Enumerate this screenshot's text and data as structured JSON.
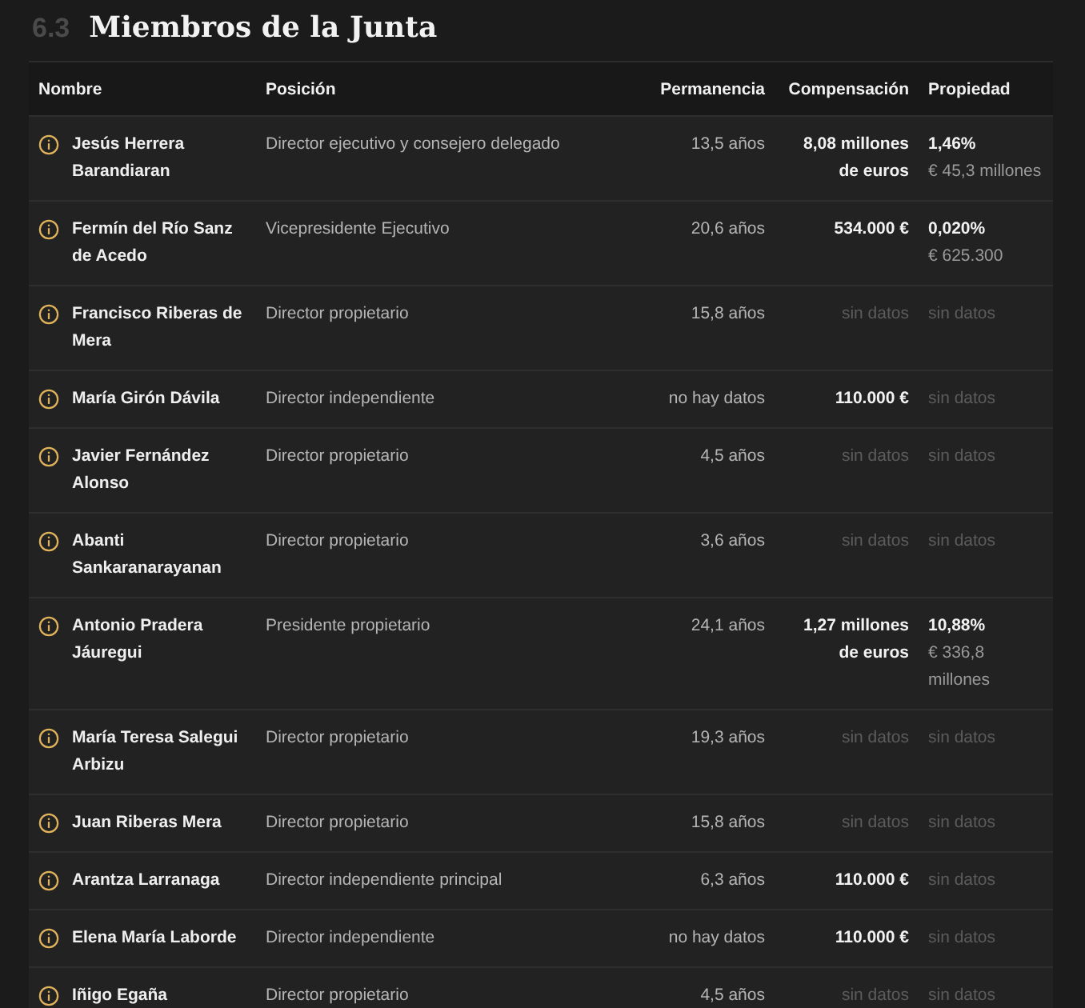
{
  "section": {
    "number": "6.3",
    "title": "Miembros de la Junta"
  },
  "table": {
    "columns": [
      "Nombre",
      "Posición",
      "Permanencia",
      "Compensación",
      "Propiedad"
    ],
    "rows": [
      {
        "name": "Jesús Herrera Barandiaran",
        "position": "Director ejecutivo y consejero delegado",
        "tenure": "13,5 años",
        "compensation": {
          "kind": "value",
          "text": "8,08 millones de euros"
        },
        "ownership": {
          "kind": "value",
          "percent": "1,46%",
          "amount": "€ 45,3 millones"
        }
      },
      {
        "name": "Fermín del Río Sanz de Acedo",
        "position": "Vicepresidente Ejecutivo",
        "tenure": "20,6 años",
        "compensation": {
          "kind": "value",
          "text": "534.000 €"
        },
        "ownership": {
          "kind": "value",
          "percent": "0,020%",
          "amount": "€ 625.300"
        }
      },
      {
        "name": "Francisco Riberas de Mera",
        "position": "Director propietario",
        "tenure": "15,8 años",
        "compensation": {
          "kind": "none",
          "text": "sin datos"
        },
        "ownership": {
          "kind": "none",
          "percent": "sin datos"
        }
      },
      {
        "name": "María Girón Dávila",
        "position": "Director independiente",
        "tenure": "no hay datos",
        "compensation": {
          "kind": "value",
          "text": "110.000 €"
        },
        "ownership": {
          "kind": "none",
          "percent": "sin datos"
        }
      },
      {
        "name": "Javier Fernández Alonso",
        "position": "Director propietario",
        "tenure": "4,5 años",
        "compensation": {
          "kind": "none",
          "text": "sin datos"
        },
        "ownership": {
          "kind": "none",
          "percent": "sin datos"
        }
      },
      {
        "name": "Abanti Sankaranarayanan",
        "position": "Director propietario",
        "tenure": "3,6 años",
        "compensation": {
          "kind": "none",
          "text": "sin datos"
        },
        "ownership": {
          "kind": "none",
          "percent": "sin datos"
        }
      },
      {
        "name": "Antonio Pradera Jáuregui",
        "position": "Presidente propietario",
        "tenure": "24,1 años",
        "compensation": {
          "kind": "value",
          "text": "1,27 millones de euros"
        },
        "ownership": {
          "kind": "value",
          "percent": "10,88%",
          "amount": "€ 336,8 millones"
        }
      },
      {
        "name": "María Teresa Salegui Arbizu",
        "position": "Director propietario",
        "tenure": "19,3 años",
        "compensation": {
          "kind": "none",
          "text": "sin datos"
        },
        "ownership": {
          "kind": "none",
          "percent": "sin datos"
        }
      },
      {
        "name": "Juan Riberas Mera",
        "position": "Director propietario",
        "tenure": "15,8 años",
        "compensation": {
          "kind": "none",
          "text": "sin datos"
        },
        "ownership": {
          "kind": "none",
          "percent": "sin datos"
        }
      },
      {
        "name": "Arantza Larranaga",
        "position": "Director independiente principal",
        "tenure": "6,3 años",
        "compensation": {
          "kind": "value",
          "text": "110.000 €"
        },
        "ownership": {
          "kind": "none",
          "percent": "sin datos"
        }
      },
      {
        "name": "Elena María Laborde",
        "position": "Director independiente",
        "tenure": "no hay datos",
        "compensation": {
          "kind": "value",
          "text": "110.000 €"
        },
        "ownership": {
          "kind": "none",
          "percent": "sin datos"
        }
      },
      {
        "name": "Iñigo Egaña",
        "position": "Director propietario",
        "tenure": "4,5 años",
        "compensation": {
          "kind": "none",
          "text": "sin datos"
        },
        "ownership": {
          "kind": "none",
          "percent": "sin datos"
        }
      }
    ]
  }
}
